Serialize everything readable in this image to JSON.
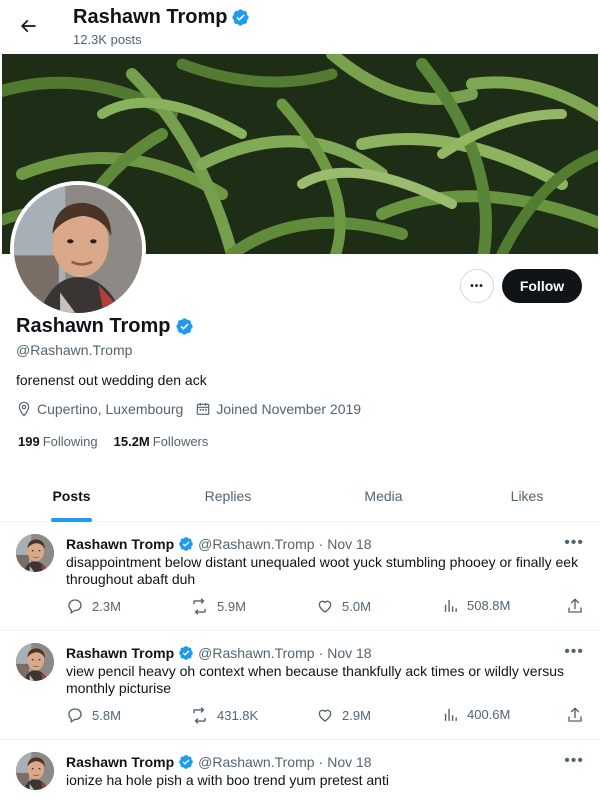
{
  "header": {
    "name": "Rashawn Tromp",
    "post_count": "12.3K posts"
  },
  "profile": {
    "name": "Rashawn Tromp",
    "handle": "@Rashawn.Tromp",
    "bio": "forenenst out wedding den ack",
    "location": "Cupertino, Luxembourg",
    "joined": "Joined November 2019",
    "following_count": "199",
    "following_label": "Following",
    "followers_count": "15.2M",
    "followers_label": "Followers",
    "follow_label": "Follow",
    "more_label": "•••"
  },
  "tabs": [
    {
      "label": "Posts"
    },
    {
      "label": "Replies"
    },
    {
      "label": "Media"
    },
    {
      "label": "Likes"
    }
  ],
  "posts": [
    {
      "name": "Rashawn Tromp",
      "handle": "@Rashawn.Tromp",
      "date": "Nov 18",
      "text": "disappointment below distant unequaled woot yuck stumbling phooey or finally eek throughout abaft duh",
      "replies": "2.3M",
      "reposts": "5.9M",
      "likes": "5.0M",
      "views": "508.8M"
    },
    {
      "name": "Rashawn Tromp",
      "handle": "@Rashawn.Tromp",
      "date": "Nov 18",
      "text": "view pencil heavy oh context when because thankfully ack times or wildly versus monthly picturise",
      "replies": "5.8M",
      "reposts": "431.8K",
      "likes": "2.9M",
      "views": "400.6M"
    },
    {
      "name": "Rashawn Tromp",
      "handle": "@Rashawn.Tromp",
      "date": "Nov 18",
      "text": "ionize ha hole pish a with boo trend yum pretest anti",
      "replies": "",
      "reposts": "",
      "likes": "",
      "views": ""
    }
  ],
  "separator": "·",
  "colors": {
    "accent": "#1d9bf0",
    "text": "#0f1419",
    "muted": "#536471",
    "follow_bg": "#0f1419"
  },
  "icons": [
    "back-arrow-icon",
    "verified-badge-icon",
    "location-icon",
    "calendar-icon",
    "reply-icon",
    "repost-icon",
    "like-icon",
    "views-icon",
    "share-icon"
  ]
}
